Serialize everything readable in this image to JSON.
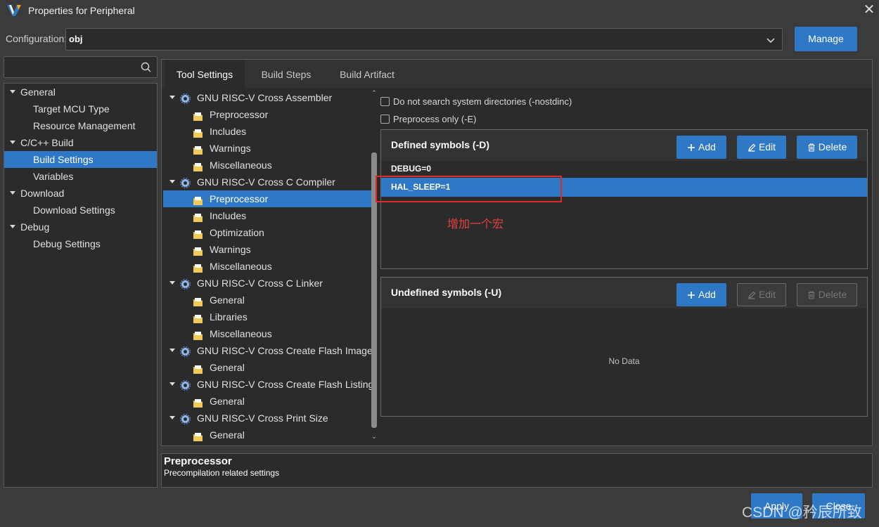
{
  "window": {
    "title": "Properties for Peripheral",
    "close_glyph": "✕"
  },
  "config": {
    "label": "Configuration:",
    "value": "obj",
    "manage_label": "Manage"
  },
  "search": {
    "value": "",
    "placeholder": ""
  },
  "nav": {
    "items": [
      {
        "label": "General",
        "level": 0,
        "expanded": true
      },
      {
        "label": "Target MCU Type",
        "level": 1
      },
      {
        "label": "Resource Management",
        "level": 1
      },
      {
        "label": "C/C++ Build",
        "level": 0,
        "expanded": true
      },
      {
        "label": "Build Settings",
        "level": 1,
        "selected": true
      },
      {
        "label": "Variables",
        "level": 1
      },
      {
        "label": "Download",
        "level": 0,
        "expanded": true
      },
      {
        "label": "Download Settings",
        "level": 1
      },
      {
        "label": "Debug",
        "level": 0,
        "expanded": true
      },
      {
        "label": "Debug Settings",
        "level": 1
      }
    ]
  },
  "tabs": [
    {
      "label": "Tool Settings",
      "active": true
    },
    {
      "label": "Build Steps",
      "active": false
    },
    {
      "label": "Build Artifact",
      "active": false
    }
  ],
  "tool_tree": {
    "items": [
      {
        "label": "GNU RISC-V Cross Assembler",
        "type": "tool",
        "icon": "gear-icon"
      },
      {
        "label": "Preprocessor",
        "type": "option",
        "icon": "folder-icon"
      },
      {
        "label": "Includes",
        "type": "option",
        "icon": "folder-icon"
      },
      {
        "label": "Warnings",
        "type": "option",
        "icon": "folder-icon"
      },
      {
        "label": "Miscellaneous",
        "type": "option",
        "icon": "folder-icon"
      },
      {
        "label": "GNU RISC-V Cross C Compiler",
        "type": "tool",
        "icon": "gear-icon"
      },
      {
        "label": "Preprocessor",
        "type": "option",
        "icon": "folder-icon",
        "selected": true
      },
      {
        "label": "Includes",
        "type": "option",
        "icon": "folder-icon"
      },
      {
        "label": "Optimization",
        "type": "option",
        "icon": "folder-icon"
      },
      {
        "label": "Warnings",
        "type": "option",
        "icon": "folder-icon"
      },
      {
        "label": "Miscellaneous",
        "type": "option",
        "icon": "folder-icon"
      },
      {
        "label": "GNU RISC-V Cross C Linker",
        "type": "tool",
        "icon": "gear-icon"
      },
      {
        "label": "General",
        "type": "option",
        "icon": "folder-icon"
      },
      {
        "label": "Libraries",
        "type": "option",
        "icon": "folder-icon"
      },
      {
        "label": "Miscellaneous",
        "type": "option",
        "icon": "folder-icon"
      },
      {
        "label": "GNU RISC-V Cross Create Flash Image",
        "type": "tool",
        "icon": "gear-icon"
      },
      {
        "label": "General",
        "type": "option",
        "icon": "folder-icon"
      },
      {
        "label": "GNU RISC-V Cross Create Flash Listing",
        "type": "tool",
        "icon": "gear-icon"
      },
      {
        "label": "General",
        "type": "option",
        "icon": "folder-icon"
      },
      {
        "label": "GNU RISC-V Cross Print Size",
        "type": "tool",
        "icon": "gear-icon"
      },
      {
        "label": "General",
        "type": "option",
        "icon": "folder-icon"
      }
    ]
  },
  "options": {
    "nostdinc": {
      "label": "Do not search system directories (-nostdinc)",
      "checked": false
    },
    "preprocess_only": {
      "label": "Preprocess only (-E)",
      "checked": false
    }
  },
  "defined": {
    "title": "Defined symbols (-D)",
    "add_label": "Add",
    "edit_label": "Edit",
    "delete_label": "Delete",
    "rows": [
      {
        "value": "DEBUG=0",
        "selected": false
      },
      {
        "value": "HAL_SLEEP=1",
        "selected": true
      }
    ]
  },
  "annotation": {
    "text": "增加一个宏",
    "color": "#e02a2a"
  },
  "undefined": {
    "title": "Undefined symbols (-U)",
    "add_label": "Add",
    "edit_label": "Edit",
    "delete_label": "Delete",
    "empty_text": "No Data"
  },
  "description": {
    "title": "Preprocessor",
    "text": "Precompilation related settings"
  },
  "footer": {
    "apply_label": "Apply",
    "close_label": "Close"
  },
  "watermark": "CSDN @矜辰所致",
  "colors": {
    "accent": "#2f78c6",
    "background": "#3b3b3b",
    "panel": "#2b2b2b"
  }
}
